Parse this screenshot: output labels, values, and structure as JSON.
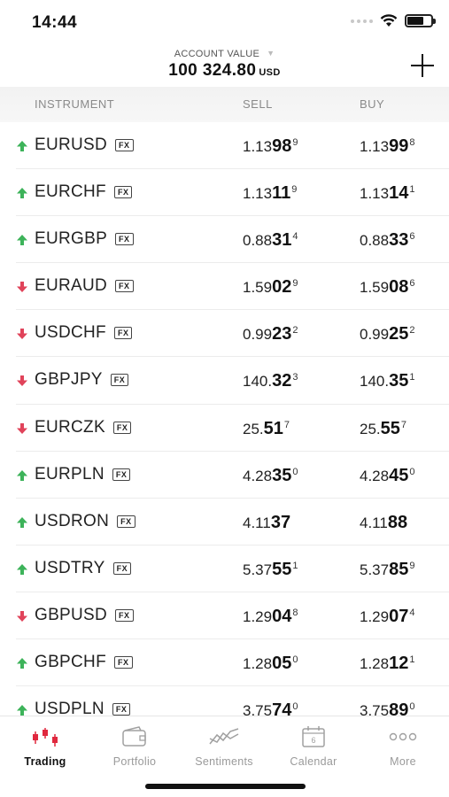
{
  "status_bar": {
    "time": "14:44"
  },
  "header": {
    "account_label": "ACCOUNT VALUE",
    "account_value": "100 324.80",
    "account_currency": "USD"
  },
  "columns": {
    "instrument": "INSTRUMENT",
    "sell": "SELL",
    "buy": "BUY"
  },
  "colors": {
    "up": "#3db35a",
    "down": "#e0435a",
    "active_tab": "#e0283e"
  },
  "instruments": [
    {
      "symbol": "EURUSD",
      "badge": "FX",
      "direction": "up",
      "sell": {
        "pre": "1.13",
        "big": "98",
        "pip": "9"
      },
      "buy": {
        "pre": "1.13",
        "big": "99",
        "pip": "8"
      }
    },
    {
      "symbol": "EURCHF",
      "badge": "FX",
      "direction": "up",
      "sell": {
        "pre": "1.13",
        "big": "11",
        "pip": "9"
      },
      "buy": {
        "pre": "1.13",
        "big": "14",
        "pip": "1"
      }
    },
    {
      "symbol": "EURGBP",
      "badge": "FX",
      "direction": "up",
      "sell": {
        "pre": "0.88",
        "big": "31",
        "pip": "4"
      },
      "buy": {
        "pre": "0.88",
        "big": "33",
        "pip": "6"
      }
    },
    {
      "symbol": "EURAUD",
      "badge": "FX",
      "direction": "down",
      "sell": {
        "pre": "1.59",
        "big": "02",
        "pip": "9"
      },
      "buy": {
        "pre": "1.59",
        "big": "08",
        "pip": "6"
      }
    },
    {
      "symbol": "USDCHF",
      "badge": "FX",
      "direction": "down",
      "sell": {
        "pre": "0.99",
        "big": "23",
        "pip": "2"
      },
      "buy": {
        "pre": "0.99",
        "big": "25",
        "pip": "2"
      }
    },
    {
      "symbol": "GBPJPY",
      "badge": "FX",
      "direction": "down",
      "sell": {
        "pre": "140.",
        "big": "32",
        "pip": "3"
      },
      "buy": {
        "pre": "140.",
        "big": "35",
        "pip": "1"
      }
    },
    {
      "symbol": "EURCZK",
      "badge": "FX",
      "direction": "down",
      "sell": {
        "pre": "25.",
        "big": "51",
        "pip": "7"
      },
      "buy": {
        "pre": "25.",
        "big": "55",
        "pip": "7"
      }
    },
    {
      "symbol": "EURPLN",
      "badge": "FX",
      "direction": "up",
      "sell": {
        "pre": "4.28",
        "big": "35",
        "pip": "0"
      },
      "buy": {
        "pre": "4.28",
        "big": "45",
        "pip": "0"
      }
    },
    {
      "symbol": "USDRON",
      "badge": "FX",
      "direction": "up",
      "sell": {
        "pre": "4.11",
        "big": "37",
        "pip": ""
      },
      "buy": {
        "pre": "4.11",
        "big": "88",
        "pip": ""
      }
    },
    {
      "symbol": "USDTRY",
      "badge": "FX",
      "direction": "up",
      "sell": {
        "pre": "5.37",
        "big": "55",
        "pip": "1"
      },
      "buy": {
        "pre": "5.37",
        "big": "85",
        "pip": "9"
      }
    },
    {
      "symbol": "GBPUSD",
      "badge": "FX",
      "direction": "down",
      "sell": {
        "pre": "1.29",
        "big": "04",
        "pip": "8"
      },
      "buy": {
        "pre": "1.29",
        "big": "07",
        "pip": "4"
      }
    },
    {
      "symbol": "GBPCHF",
      "badge": "FX",
      "direction": "up",
      "sell": {
        "pre": "1.28",
        "big": "05",
        "pip": "0"
      },
      "buy": {
        "pre": "1.28",
        "big": "12",
        "pip": "1"
      }
    },
    {
      "symbol": "USDPLN",
      "badge": "FX",
      "direction": "up",
      "sell": {
        "pre": "3.75",
        "big": "74",
        "pip": "0"
      },
      "buy": {
        "pre": "3.75",
        "big": "89",
        "pip": "0"
      }
    }
  ],
  "tabs": [
    {
      "label": "Trading",
      "icon": "candlestick-icon",
      "active": true
    },
    {
      "label": "Portfolio",
      "icon": "wallet-icon",
      "active": false
    },
    {
      "label": "Sentiments",
      "icon": "sentiment-chart-icon",
      "active": false
    },
    {
      "label": "Calendar",
      "icon": "calendar-icon",
      "active": false,
      "icon_text": "6"
    },
    {
      "label": "More",
      "icon": "more-dots-icon",
      "active": false
    }
  ]
}
